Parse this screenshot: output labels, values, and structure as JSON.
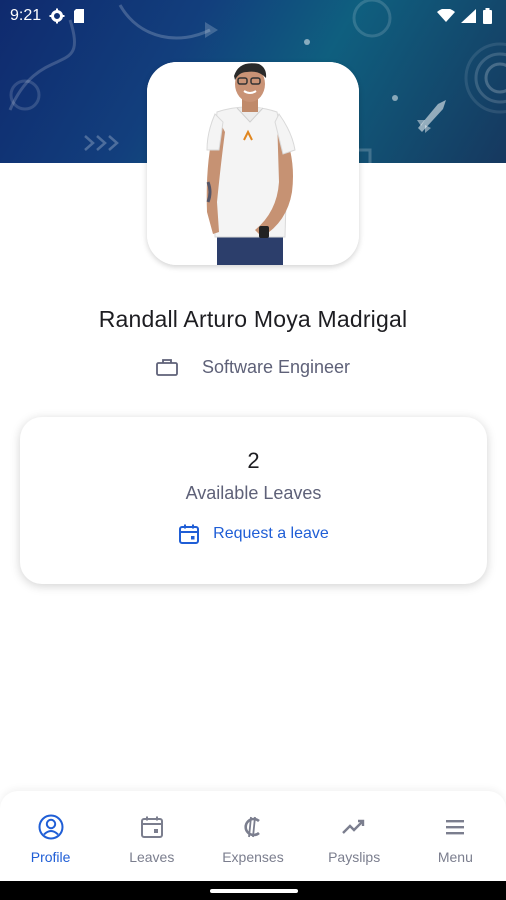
{
  "status_bar": {
    "time": "9:21"
  },
  "profile": {
    "name": "Randall Arturo Moya Madrigal",
    "job_title": "Software Engineer"
  },
  "leaves_card": {
    "count": "2",
    "caption": "Available Leaves",
    "request_label": "Request a leave"
  },
  "bottom_nav": {
    "items": [
      {
        "label": "Profile",
        "icon": "profile-icon",
        "active": true
      },
      {
        "label": "Leaves",
        "icon": "calendar-icon",
        "active": false
      },
      {
        "label": "Expenses",
        "icon": "colon-currency-icon",
        "active": false
      },
      {
        "label": "Payslips",
        "icon": "trending-up-icon",
        "active": false
      },
      {
        "label": "Menu",
        "icon": "menu-icon",
        "active": false
      }
    ]
  },
  "colors": {
    "accent": "#1f5ed6",
    "header_dark": "#0f2a6e",
    "header_teal": "#0f5f7f",
    "text_primary": "#1d1d21",
    "text_secondary": "#5e6178",
    "nav_inactive": "#7b7e8e"
  }
}
